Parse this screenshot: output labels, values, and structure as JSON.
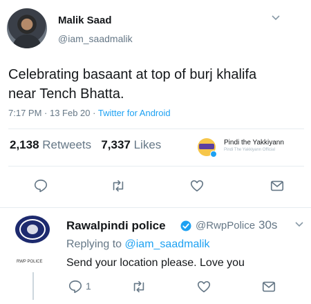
{
  "tweet": {
    "author_name": "Malik Saad",
    "author_handle": "@iam_saadmalik",
    "text": "Celebrating basaant at top of burj khalifa near Tench Bhatta.",
    "time": "7:17 PM · 13 Feb 20 · ",
    "source": "Twitter for Android",
    "retweets_count": "2,138",
    "retweets_label": "Retweets",
    "likes_count": "7,337",
    "likes_label": "Likes",
    "liker_name": "Pindi the Yakkiyann",
    "liker_sub": "Pindi The Yakkiyann Official"
  },
  "reply": {
    "author_name": "Rawalpindi police",
    "author_handle": "@RwpPolice",
    "time": "30s",
    "replying_prefix": "Replying to ",
    "replying_to": "@iam_saadmalik",
    "text": "Send your location please. Love you",
    "reply_count": "1",
    "avatar_caption": "RWP POLICE"
  },
  "icons": {
    "reply": "reply-icon",
    "retweet": "retweet-icon",
    "like": "heart-icon",
    "share": "share-envelope-icon",
    "more": "chevron-down-icon",
    "verified": "verified-badge-icon"
  },
  "colors": {
    "accent": "#1da1f2",
    "secondary_text": "#657786",
    "icon": "#657786"
  }
}
